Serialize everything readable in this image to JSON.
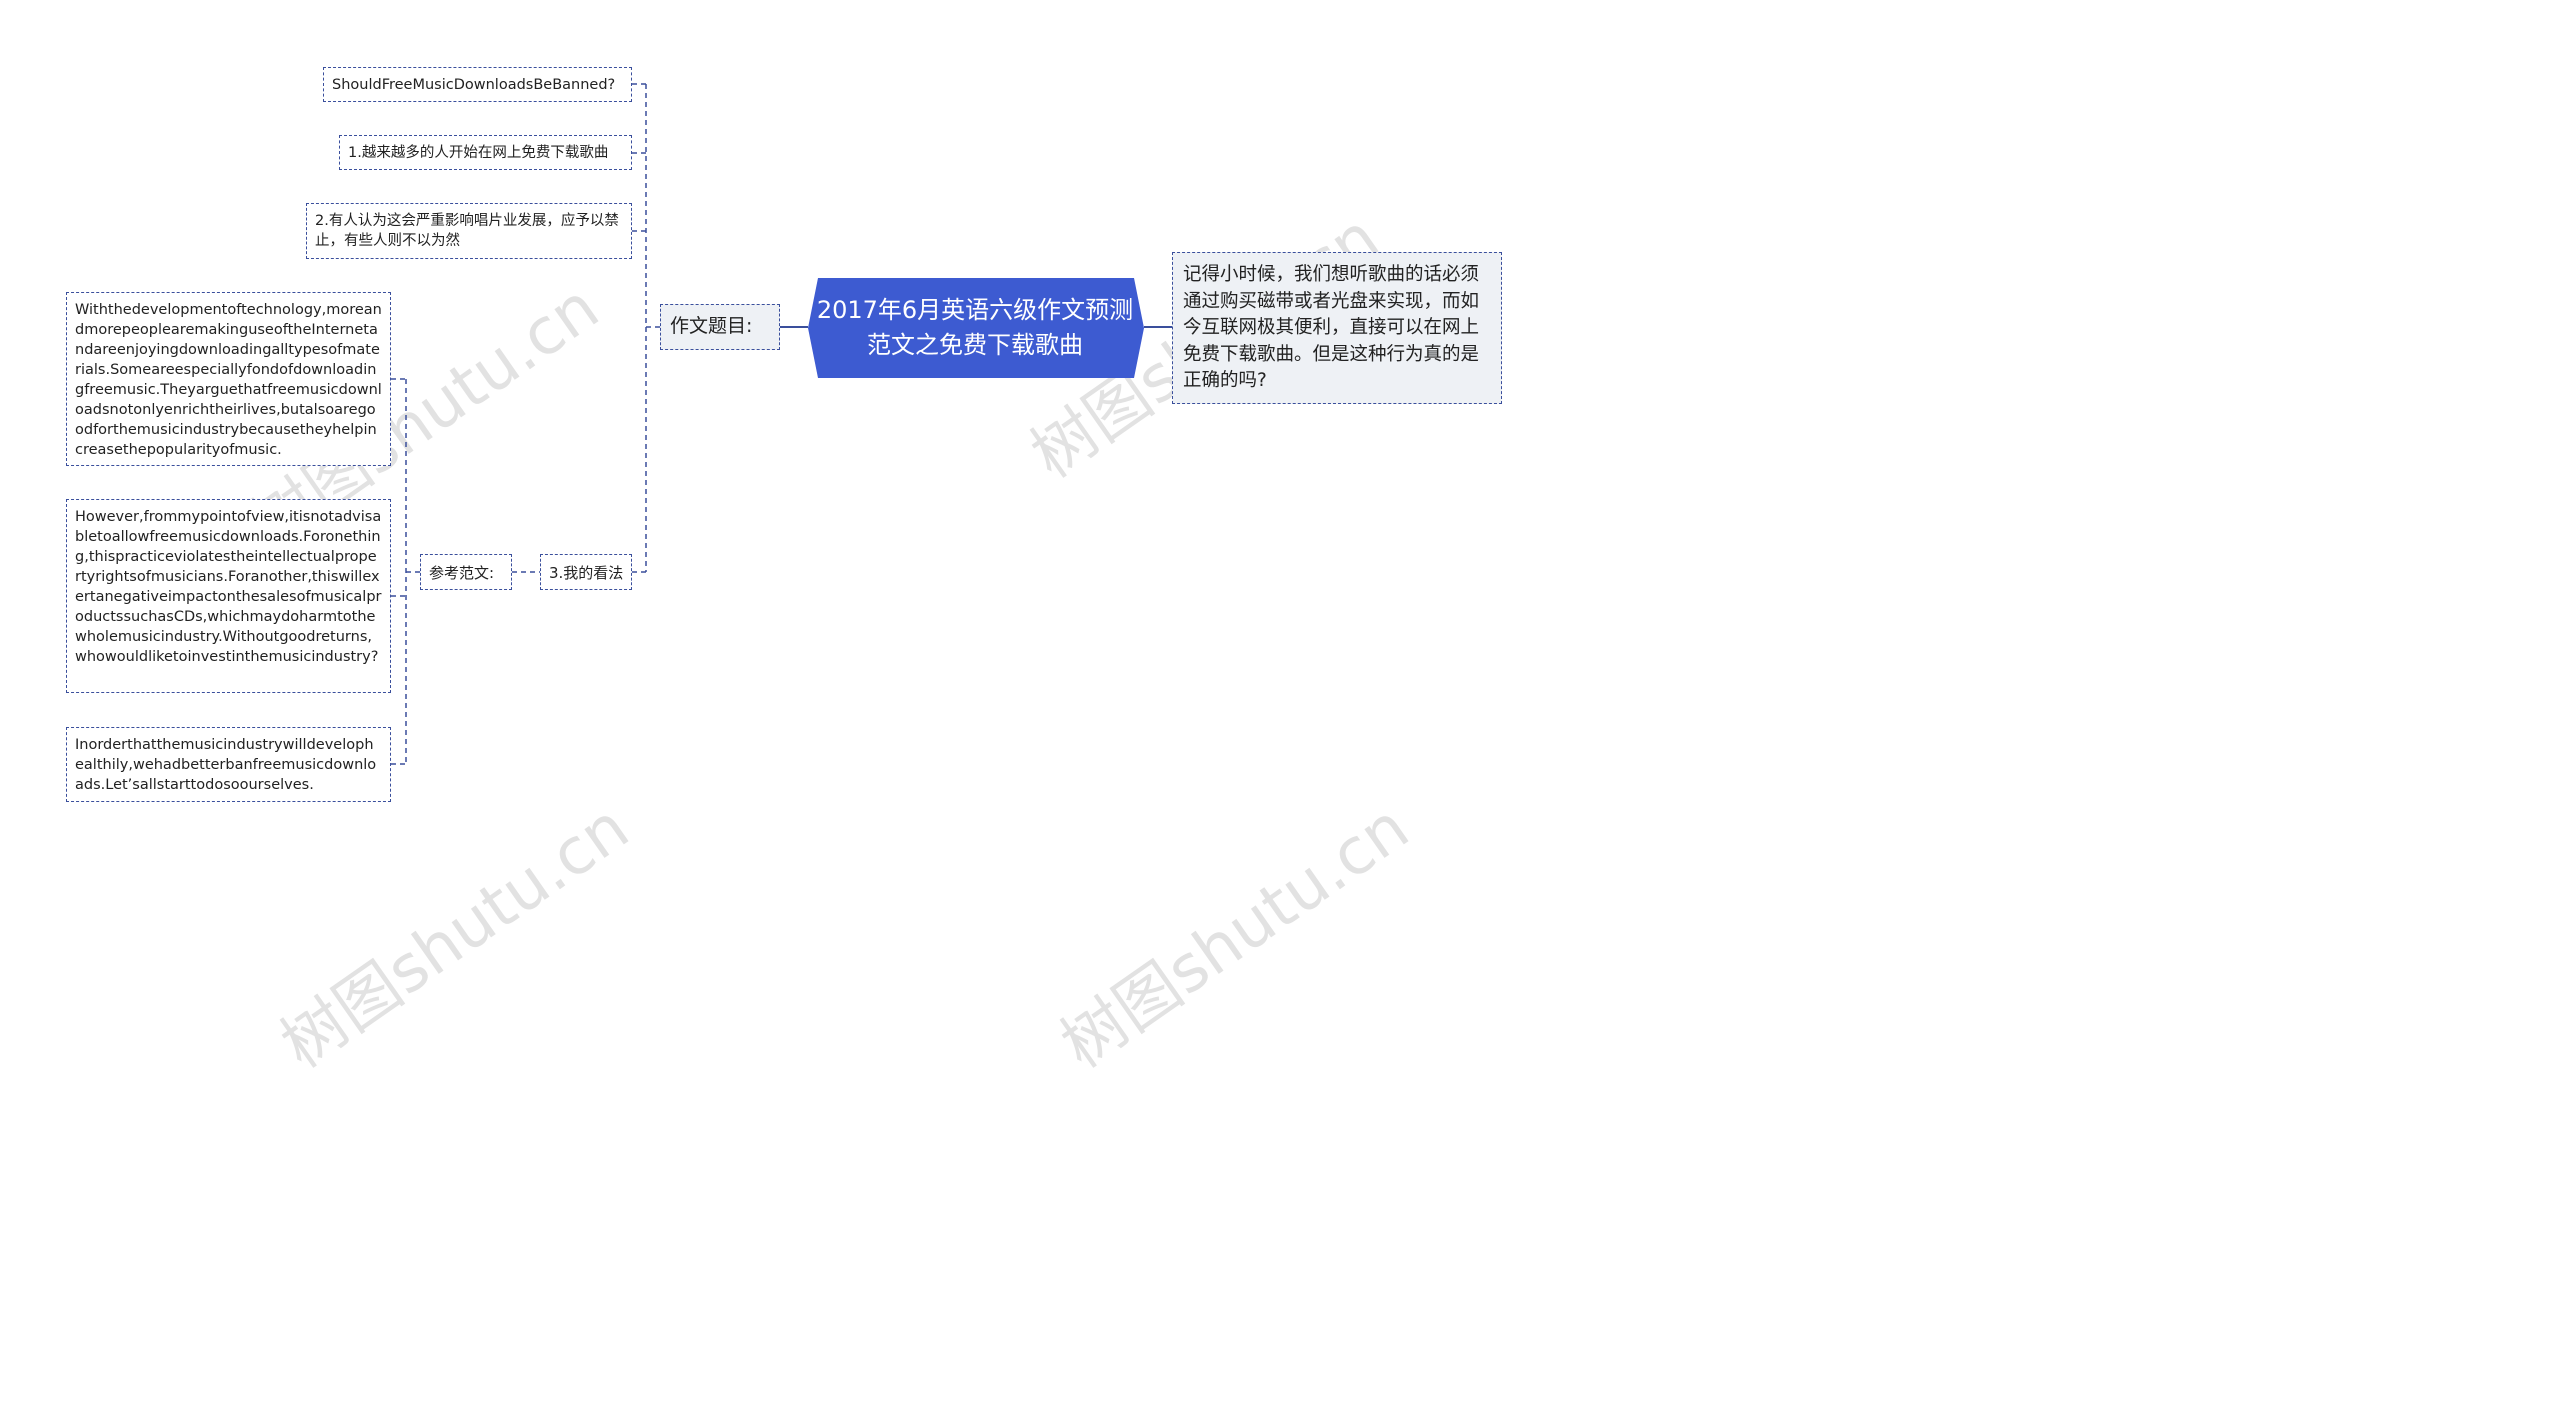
{
  "center": {
    "title": "2017年6月英语六级作文预测范文之免费下载歌曲"
  },
  "description": "记得小时候，我们想听歌曲的话必须通过购买磁带或者光盘来实现，而如今互联网极其便利，直接可以在网上免费下载歌曲。但是这种行为真的是正确的吗?",
  "topic": {
    "label": "作文题目:",
    "title_en": "ShouldFreeMusicDownloadsBeBanned?",
    "point1": "1.越来越多的人开始在网上免费下载歌曲",
    "point2": "2.有人认为这会严重影响唱片业发展，应予以禁止，有些人则不以为然",
    "point3": "3.我的看法"
  },
  "sample": {
    "label": "参考范文:",
    "paragraphs": [
      "Withthedevelopmentoftechnology,moreandmorepeoplearemakinguseoftheInternetandareenjoyingdownloadingalltypesofmaterials.Someareespeciallyfondofdownloadingfreemusic.Theyarguethatfreemusicdownloadsnotonlyenrichtheirlives,butalsoaregoodforthemusicindustrybecausetheyhelpincreasethepopularityofmusic.",
      "However,frommypointofview,itisnotadvisabletoallowfreemusicdownloads.Foronething,thispracticeviolatestheintellectualpropertyrightsofmusicians.Foranother,thiswillexertanegativeimpactonthesalesofmusicalproductssuchasCDs,whichmaydoharmtothewholemusicindustry.Withoutgoodreturns,whowouldliketoinvestinthemusicindustry?",
      "Inorderthatthemusicindustrywilldevelophealthily,wehadbetterbanfreemusicdownloads.Let’sallstarttodosoourselves."
    ]
  },
  "watermark": {
    "text": "树图shutu.cn"
  },
  "colors": {
    "center_fill": "#3d5bd1",
    "border": "#3a4f9c",
    "sub_fill": "#eef1f5"
  }
}
